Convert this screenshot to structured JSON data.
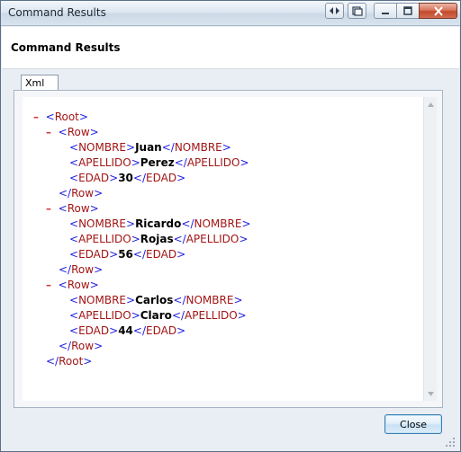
{
  "window": {
    "title": "Command Results"
  },
  "header": {
    "title": "Command Results"
  },
  "tabs": [
    {
      "label": "Xml"
    }
  ],
  "xml": {
    "minus": "–",
    "root_tag": "Root",
    "rows": [
      {
        "row_tag": "Row",
        "fields": [
          {
            "tag": "NOMBRE",
            "value": "Juan"
          },
          {
            "tag": "APELLIDO",
            "value": "Perez"
          },
          {
            "tag": "EDAD",
            "value": "30"
          }
        ]
      },
      {
        "row_tag": "Row",
        "fields": [
          {
            "tag": "NOMBRE",
            "value": "Ricardo"
          },
          {
            "tag": "APELLIDO",
            "value": "Rojas"
          },
          {
            "tag": "EDAD",
            "value": "56"
          }
        ]
      },
      {
        "row_tag": "Row",
        "fields": [
          {
            "tag": "NOMBRE",
            "value": "Carlos"
          },
          {
            "tag": "APELLIDO",
            "value": "Claro"
          },
          {
            "tag": "EDAD",
            "value": "44"
          }
        ]
      }
    ]
  },
  "buttons": {
    "close_label": "Close"
  },
  "colors": {
    "minus": "#d23a3a",
    "bracket": "#1d1de0",
    "tag": "#a31515",
    "value": "#000000"
  }
}
